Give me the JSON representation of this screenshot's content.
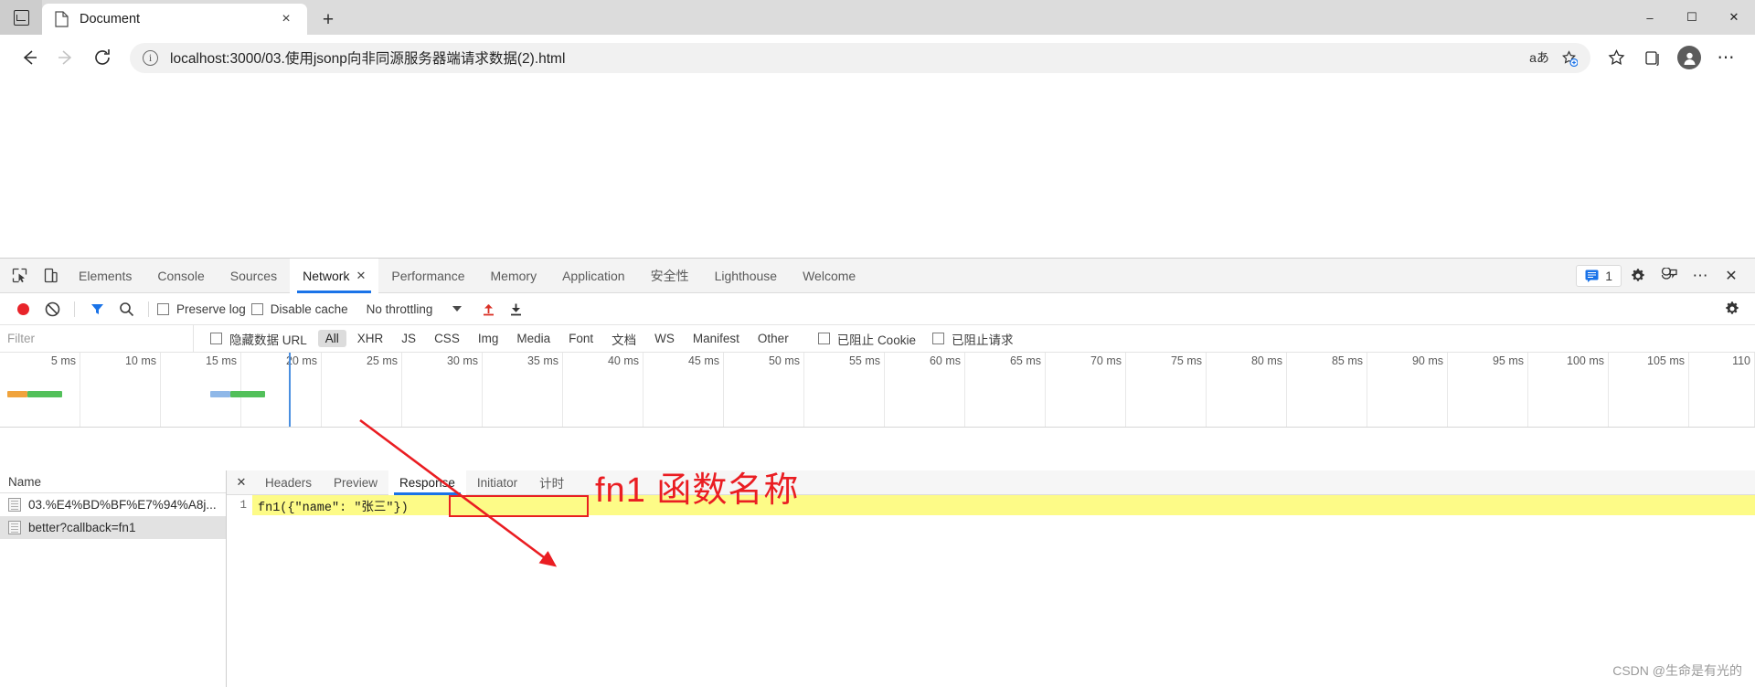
{
  "browser": {
    "tab": {
      "title": "Document",
      "close_label": "×",
      "favicon": "page-icon"
    },
    "new_tab_label": "+",
    "vertical_tabs_icon": "vertical-tabs-icon",
    "window_controls": {
      "minimize": "–",
      "maximize": "☐",
      "close": "✕"
    },
    "nav": {
      "back": "←",
      "forward": "→",
      "reload": "⟳"
    },
    "omnibox": {
      "info_icon": "ⓘ",
      "url": "localhost:3000/03.使用jsonp向非同源服务器端请求数据(2).html",
      "reading_mode_label": "aあ",
      "favorite_icon": "add-favorite-icon"
    },
    "toolbar": {
      "favorites_icon": "favorites-star-icon",
      "collections_icon": "collections-icon",
      "profile_icon": "profile-avatar",
      "more_icon": "⋯"
    }
  },
  "devtools": {
    "tabs": [
      {
        "label": "Elements",
        "active": false
      },
      {
        "label": "Console",
        "active": false
      },
      {
        "label": "Sources",
        "active": false
      },
      {
        "label": "Network",
        "active": true,
        "close": "✕"
      },
      {
        "label": "Performance",
        "active": false
      },
      {
        "label": "Memory",
        "active": false
      },
      {
        "label": "Application",
        "active": false
      },
      {
        "label": "安全性",
        "active": false
      },
      {
        "label": "Lighthouse",
        "active": false
      },
      {
        "label": "Welcome",
        "active": false
      }
    ],
    "header_icons": {
      "inspect": "inspect-element-icon",
      "device_toolbar": "device-toolbar-icon",
      "message_count": "1",
      "message_icon": "message-icon",
      "settings_icon": "gear-icon",
      "feedback_icon": "feedback-icon",
      "more_icon": "⋯",
      "close_icon": "✕"
    },
    "network_toolbar": {
      "record_icon": "record-icon",
      "clear_icon": "clear-icon",
      "filter_icon": "filter-icon",
      "search_icon": "search-icon",
      "preserve_log": "Preserve log",
      "disable_cache": "Disable cache",
      "throttling": "No throttling",
      "import_icon": "import-har-icon",
      "export_icon": "export-har-icon",
      "settings_icon": "network-settings-icon"
    },
    "filter_row": {
      "filter_placeholder": "Filter",
      "hide_data_urls": "隐藏数据 URL",
      "types": [
        {
          "label": "All",
          "selected": true
        },
        {
          "label": "XHR",
          "selected": false
        },
        {
          "label": "JS",
          "selected": false
        },
        {
          "label": "CSS",
          "selected": false
        },
        {
          "label": "Img",
          "selected": false
        },
        {
          "label": "Media",
          "selected": false
        },
        {
          "label": "Font",
          "selected": false
        },
        {
          "label": "文档",
          "selected": false
        },
        {
          "label": "WS",
          "selected": false
        },
        {
          "label": "Manifest",
          "selected": false
        },
        {
          "label": "Other",
          "selected": false
        }
      ],
      "blocked_cookies": "已阻止 Cookie",
      "blocked_requests": "已阻止请求"
    },
    "overview": {
      "ticks": [
        "5 ms",
        "10 ms",
        "15 ms",
        "20 ms",
        "25 ms",
        "30 ms",
        "35 ms",
        "40 ms",
        "45 ms",
        "50 ms",
        "55 ms",
        "60 ms",
        "65 ms",
        "70 ms",
        "75 ms",
        "80 ms",
        "85 ms",
        "90 ms",
        "95 ms",
        "100 ms",
        "105 ms",
        "110"
      ]
    },
    "request_list": {
      "header": "Name",
      "rows": [
        {
          "name": "03.%E4%BD%BF%E7%94%A8j...",
          "selected": false
        },
        {
          "name": "better?callback=fn1",
          "selected": true
        }
      ]
    },
    "detail": {
      "close_label": "✕",
      "tabs": [
        {
          "label": "Headers",
          "active": false
        },
        {
          "label": "Preview",
          "active": false
        },
        {
          "label": "Response",
          "active": true
        },
        {
          "label": "Initiator",
          "active": false
        },
        {
          "label": "计时",
          "active": false
        }
      ],
      "response": {
        "line_number": "1",
        "content": "fn1({\"name\": \"张三\"})"
      }
    }
  },
  "annotation": {
    "text": "fn1 函数名称",
    "color": "#ea1d22"
  },
  "watermark": "CSDN @生命是有光的"
}
